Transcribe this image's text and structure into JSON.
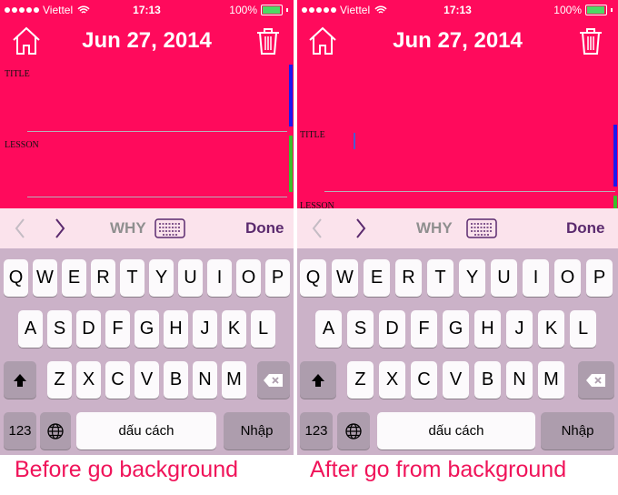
{
  "screens": [
    {
      "status": {
        "carrier": "Viettel",
        "time": "17:13",
        "battery": "100%"
      },
      "nav": {
        "title": "Jun 27, 2014",
        "left_icon": "home-icon",
        "right_icon": "trash-icon"
      },
      "fields": [
        {
          "label": "TITLE"
        },
        {
          "label": "LESSON"
        }
      ],
      "accessory": {
        "why": "WHY",
        "done": "Done"
      },
      "keyboard": {
        "row1": [
          "Q",
          "W",
          "E",
          "R",
          "T",
          "Y",
          "U",
          "I",
          "O",
          "P"
        ],
        "row2": [
          "A",
          "S",
          "D",
          "F",
          "G",
          "H",
          "J",
          "K",
          "L"
        ],
        "row3": [
          "Z",
          "X",
          "C",
          "V",
          "B",
          "N",
          "M"
        ],
        "numbers": "123",
        "space": "dấu cách",
        "return": "Nhập"
      },
      "caption": "Before go background"
    },
    {
      "status": {
        "carrier": "Viettel",
        "time": "17:13",
        "battery": "100%"
      },
      "nav": {
        "title": "Jun 27, 2014",
        "left_icon": "home-icon",
        "right_icon": "trash-icon"
      },
      "fields": [
        {
          "label": "TITLE"
        },
        {
          "label": "LESSON"
        }
      ],
      "accessory": {
        "why": "WHY",
        "done": "Done"
      },
      "keyboard": {
        "row1": [
          "Q",
          "W",
          "E",
          "R",
          "T",
          "Y",
          "U",
          "I",
          "O",
          "P"
        ],
        "row2": [
          "A",
          "S",
          "D",
          "F",
          "G",
          "H",
          "J",
          "K",
          "L"
        ],
        "row3": [
          "Z",
          "X",
          "C",
          "V",
          "B",
          "N",
          "M"
        ],
        "numbers": "123",
        "space": "dấu cách",
        "return": "Nhập"
      },
      "caption": "After go from background"
    }
  ],
  "colors": {
    "background": "#ff0a5c",
    "accent": "#5b2a6e",
    "caption": "#f0145a",
    "keyboard": "#cbb2c8"
  }
}
